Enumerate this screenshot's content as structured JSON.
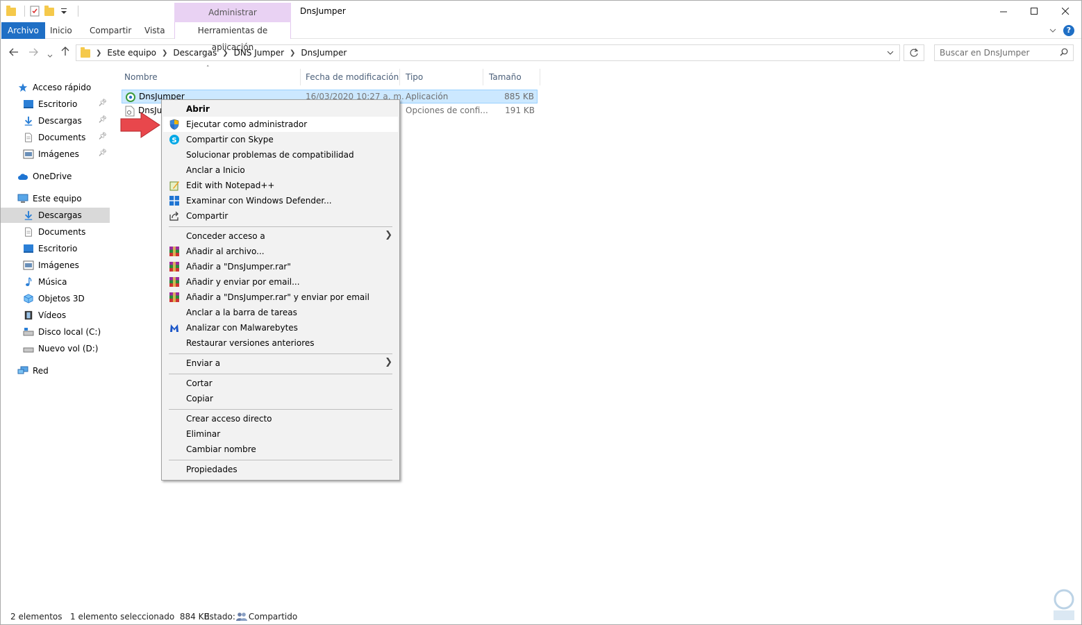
{
  "window": {
    "title": "DnsJumper",
    "context_tab_group": "Administrar"
  },
  "ribbon": {
    "tabs": [
      "Archivo",
      "Inicio",
      "Compartir",
      "Vista",
      "Herramientas de aplicación"
    ]
  },
  "address": {
    "crumbs": [
      "Este equipo",
      "Descargas",
      "DNS Jumper",
      "DnsJumper"
    ],
    "search_placeholder": "Buscar en DnsJumper"
  },
  "sidebar": {
    "items": [
      {
        "label": "Acceso rápido",
        "icon": "star-icon",
        "pinned": false
      },
      {
        "label": "Escritorio",
        "icon": "desktop-icon",
        "pinned": true
      },
      {
        "label": "Descargas",
        "icon": "download-icon",
        "pinned": true
      },
      {
        "label": "Documents",
        "icon": "document-icon",
        "pinned": true
      },
      {
        "label": "Imágenes",
        "icon": "pictures-icon",
        "pinned": true
      },
      {
        "label": "OneDrive",
        "icon": "cloud-icon",
        "pinned": false
      },
      {
        "label": "Este equipo",
        "icon": "computer-icon",
        "pinned": false
      },
      {
        "label": "Descargas",
        "icon": "download-icon",
        "pinned": false,
        "selected": true
      },
      {
        "label": "Documents",
        "icon": "document-icon",
        "pinned": false
      },
      {
        "label": "Escritorio",
        "icon": "desktop-icon",
        "pinned": false
      },
      {
        "label": "Imágenes",
        "icon": "pictures-icon",
        "pinned": false
      },
      {
        "label": "Música",
        "icon": "music-icon",
        "pinned": false
      },
      {
        "label": "Objetos 3D",
        "icon": "cube-icon",
        "pinned": false
      },
      {
        "label": "Vídeos",
        "icon": "video-icon",
        "pinned": false
      },
      {
        "label": "Disco local (C:)",
        "icon": "drive-icon",
        "pinned": false
      },
      {
        "label": "Nuevo vol (D:)",
        "icon": "drive-icon",
        "pinned": false
      },
      {
        "label": "Red",
        "icon": "network-icon",
        "pinned": false
      }
    ]
  },
  "file_list": {
    "columns": [
      "Nombre",
      "Fecha de modificación",
      "Tipo",
      "Tamaño"
    ],
    "rows": [
      {
        "name": "DnsJumper",
        "date": "16/03/2020 10:27 a. m.",
        "type": "Aplicación",
        "size": "885 KB",
        "selected": true
      },
      {
        "name": "DnsJu",
        "date": "",
        "type": "Opciones de confi...",
        "size": "191 KB",
        "selected": false
      }
    ]
  },
  "context_menu": {
    "items": [
      {
        "label": "Abrir",
        "bold": true
      },
      {
        "label": "Ejecutar como administrador",
        "icon": "shield-icon",
        "hover": true
      },
      {
        "label": "Compartir con Skype",
        "icon": "skype-icon"
      },
      {
        "label": "Solucionar problemas de compatibilidad"
      },
      {
        "label": "Anclar a Inicio"
      },
      {
        "label": "Edit with Notepad++",
        "icon": "notepad-icon"
      },
      {
        "label": "Examinar con Windows Defender...",
        "icon": "defender-icon"
      },
      {
        "label": "Compartir",
        "icon": "share-icon"
      },
      {
        "label": "Conceder acceso a",
        "submenu": true
      },
      {
        "label": "Añadir al archivo...",
        "icon": "winrar-icon"
      },
      {
        "label": "Añadir a \"DnsJumper.rar\"",
        "icon": "winrar-icon"
      },
      {
        "label": "Añadir y enviar por email...",
        "icon": "winrar-icon"
      },
      {
        "label": "Añadir a \"DnsJumper.rar\" y enviar por email",
        "icon": "winrar-icon"
      },
      {
        "label": "Anclar a la barra de tareas"
      },
      {
        "label": "Analizar con Malwarebytes",
        "icon": "malwarebytes-icon"
      },
      {
        "label": "Restaurar versiones anteriores"
      },
      {
        "label": "Enviar a",
        "submenu": true
      },
      {
        "label": "Cortar"
      },
      {
        "label": "Copiar"
      },
      {
        "label": "Crear acceso directo"
      },
      {
        "label": "Eliminar"
      },
      {
        "label": "Cambiar nombre"
      },
      {
        "label": "Propiedades"
      }
    ]
  },
  "status_bar": {
    "count": "2 elementos",
    "selection": "1 elemento seleccionado  884 KB",
    "state_label": "Estado:",
    "state_value": "Compartido"
  },
  "colors": {
    "file_tab": "#1f6fc5",
    "context_tab": "#e9d2f3",
    "selection": "#cce8ff",
    "arrow": "#e8474c"
  }
}
